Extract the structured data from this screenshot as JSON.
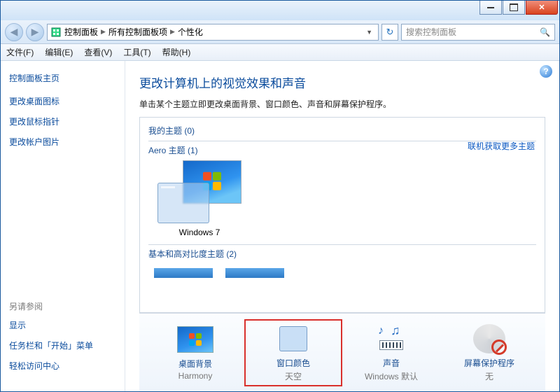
{
  "breadcrumb": {
    "root": "控制面板",
    "mid": "所有控制面板项",
    "leaf": "个性化"
  },
  "search": {
    "placeholder": "搜索控制面板"
  },
  "menu": {
    "file": "文件(F)",
    "edit": "编辑(E)",
    "view": "查看(V)",
    "tools": "工具(T)",
    "help": "帮助(H)"
  },
  "sidebar": {
    "home": "控制面板主页",
    "links": [
      "更改桌面图标",
      "更改鼠标指针",
      "更改帐户图片"
    ],
    "see_also_h": "另请参阅",
    "see_also": [
      "显示",
      "任务栏和「开始」菜单",
      "轻松访问中心"
    ]
  },
  "main": {
    "heading": "更改计算机上的视觉效果和声音",
    "sub": "单击某个主题立即更改桌面背景、窗口颜色、声音和屏幕保护程序。",
    "my_themes_h": "我的主题 (0)",
    "more_link": "联机获取更多主题",
    "aero_h": "Aero 主题 (1)",
    "aero_theme_label": "Windows 7",
    "basic_h": "基本和高对比度主题 (2)"
  },
  "bottom": {
    "bg": {
      "title": "桌面背景",
      "sub": "Harmony"
    },
    "color": {
      "title": "窗口颜色",
      "sub": "天空"
    },
    "sound": {
      "title": "声音",
      "sub": "Windows 默认"
    },
    "saver": {
      "title": "屏幕保护程序",
      "sub": "无"
    }
  }
}
